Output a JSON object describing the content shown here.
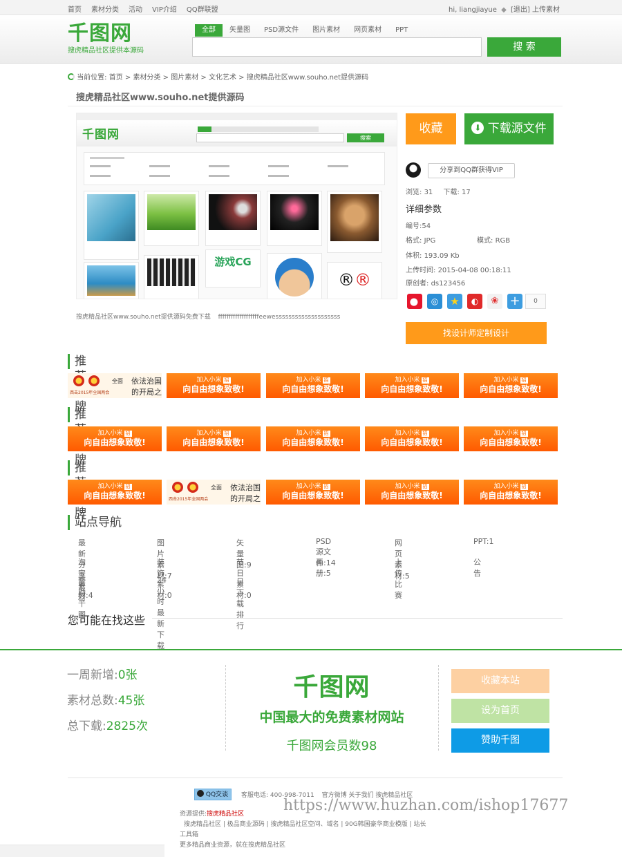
{
  "topbar": {
    "nav": [
      "首页",
      "素材分类",
      "活动",
      "VIP介绍",
      "QQ群联盟"
    ],
    "greeting": "hi, liangjiayue",
    "logout": "[退出]",
    "upload": "上传素材"
  },
  "header": {
    "logo": "千图网",
    "slogan": "搜虎精品社区提供本源码",
    "search_tabs": [
      "全部",
      "矢量图",
      "PSD源文件",
      "图片素材",
      "网页素材",
      "PPT"
    ],
    "search_value": "",
    "search_button": "搜 索"
  },
  "breadcrumb": {
    "label": "当前位置:",
    "items": [
      "首页",
      "素材分类",
      "图片素材",
      "文化艺术",
      "搜虎精品社区www.souho.net提供源码"
    ],
    "sep": " > "
  },
  "page_title": "搜虎精品社区www.souho.net提供源码",
  "preview": {
    "caption_left": "搜虎精品社区www.souho.net提供源码免费下载",
    "caption_right": "fffffffffffffffffffeewessssssssssssssssssss",
    "mini_logo": "千图网",
    "mini_search_button": "搜索",
    "game_text": "游戏CG"
  },
  "actions": {
    "favorite": "收藏",
    "download": "下载源文件",
    "share_vip": "分享到QQ群获得VIP",
    "views_label": "浏览:",
    "views": "31",
    "downloads_label": "下载:",
    "downloads": "17",
    "details_title": "详细参数",
    "id_label": "编号:",
    "id": "54",
    "format_label": "格式:",
    "format": "JPG",
    "mode_label": "模式:",
    "mode": "RGB",
    "size_label": "体积:",
    "size": "193.09 Kb",
    "upload_time_label": "上传时间:",
    "upload_time": "2015-04-08 00:18:11",
    "author_label": "原创者:",
    "author": "ds123456",
    "share_count": "0",
    "designer_button": "找设计师定制设计"
  },
  "brand_sections": [
    {
      "title": "推荐品牌",
      "items": [
        "gov",
        "mi",
        "mi",
        "mi",
        "mi"
      ]
    },
    {
      "title": "推荐品牌",
      "items": [
        "mi",
        "mi",
        "mi",
        "mi",
        "mi"
      ]
    },
    {
      "title": "推荐品牌",
      "items": [
        "mi",
        "gov",
        "mi",
        "mi",
        "mi"
      ]
    }
  ],
  "brand_mi": {
    "line1": "加入小米",
    "badge": "招",
    "line2": "向自由想象致敬!"
  },
  "brand_gov": {
    "line1": "全面",
    "line2": "依法治国",
    "line3": "的开局之",
    "note": "西击2015年全国两会"
  },
  "site_nav": {
    "title": "站点导航",
    "rows": [
      [
        "最新分享素材",
        "图片素材:7",
        "矢量图:9",
        "PSD源文件:14",
        "网页素材:5",
        "PPT:1"
      ],
      [
        "淘宝素材:4",
        "装饰素材:0",
        "节日素材:0",
        "画册:5",
        "上传比赛",
        "公告"
      ],
      [
        "赞助千图",
        "24小时最新下载",
        "日下载排行"
      ]
    ]
  },
  "maybe_title": "您可能在找这些",
  "footer_stats": {
    "weekly_label": "一周新增:",
    "weekly": "0张",
    "total_label": "素材总数:",
    "total": "45张",
    "downloads_label": "总下载:",
    "downloads": "2825次"
  },
  "footer_center": {
    "logo": "千图网",
    "tagline": "中国最大的免费素材网站",
    "members": "千图网会员数98"
  },
  "footer_buttons": {
    "bookmark": "收藏本站",
    "homepage": "设为首页",
    "sponsor": "赞助千图"
  },
  "footer_bottom": {
    "qq": "QQ交谈",
    "phone_label": "客服电话:",
    "phone": "400-998-7011",
    "links": [
      "官方微博",
      "关于我们",
      "搜虎精品社区"
    ],
    "provider_label": "资源提供:",
    "provider": "搜虎精品社区",
    "line2": "搜虎精品社区 | 极品商业源码 | 搜虎精品社区空间、域名 | 90G韩国豪华商业模版 | 站长",
    "line3": "工具箱",
    "line4": "更多精品商业资源，就在搜虎精品社区"
  },
  "watermark": "https://www.huzhan.com/ishop17677",
  "colors": {
    "green": "#3aa83a",
    "orange": "#ff8c1a",
    "blue": "#0e9be6"
  }
}
